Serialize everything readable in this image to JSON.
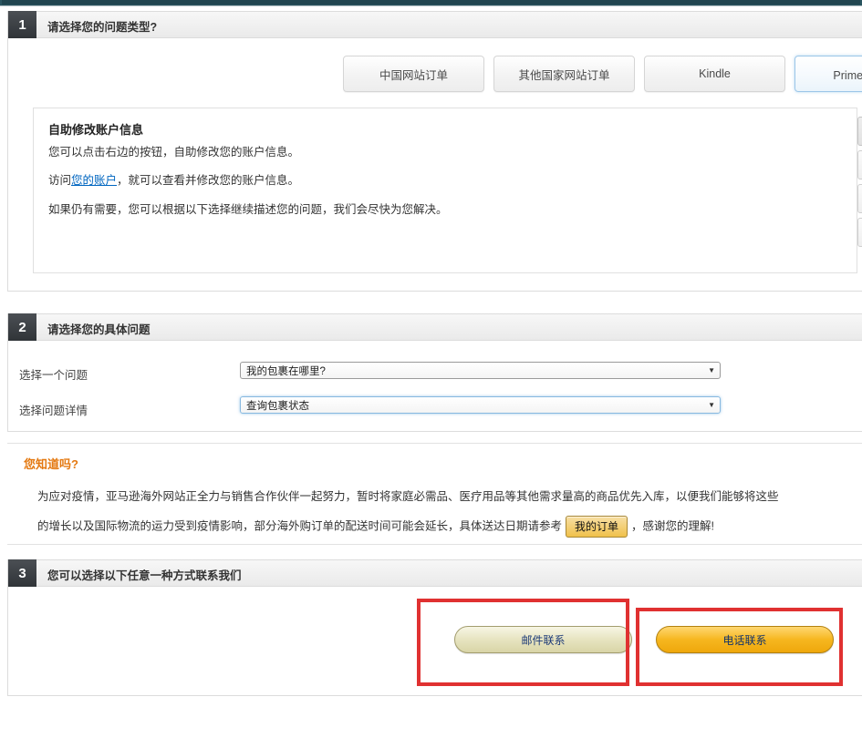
{
  "colors": {
    "topbar": "#21454f",
    "section_number_bg": "#2f3337",
    "accent_orange": "#e47911",
    "annotation_red": "#e03131",
    "link_blue": "#0066c0",
    "phone_button": "#f6b71f",
    "email_button": "#e6e3bf"
  },
  "sections": {
    "one": {
      "number": "1",
      "title": "请选择您的问题类型?",
      "tabs": [
        {
          "label": "中国网站订单",
          "selected": false
        },
        {
          "label": "其他国家网站订单",
          "selected": false
        },
        {
          "label": "Kindle",
          "selected": false
        },
        {
          "label": "Prime会员账",
          "selected": true
        }
      ],
      "info": {
        "heading": "自助修改账户信息",
        "line1": "您可以点击右边的按钮，自助修改您的账户信息。",
        "line2_prefix": "访问",
        "line2_link": "您的账户",
        "line2_suffix": "，就可以查看并修改您的账户信息。",
        "line3": "如果仍有需要，您可以根据以下选择继续描述您的问题，我们会尽快为您解决。"
      },
      "side_buttons": [
        "",
        "",
        "",
        ""
      ],
      "expand_icon": "chevron-double-down"
    },
    "two": {
      "number": "2",
      "title": "请选择您的具体问题",
      "fields": [
        {
          "label": "选择一个问题",
          "value": "我的包裹在哪里?",
          "focused": false,
          "arrow": "▼"
        },
        {
          "label": "选择问题详情",
          "value": "查询包裹状态",
          "focused": true,
          "arrow": "▼"
        }
      ]
    },
    "know": {
      "title": "您知道吗?",
      "line1": "为应对疫情，亚马逊海外网站正全力与销售合作伙伴一起努力，暂时将家庭必需品、医疗用品等其他需求量高的商品优先入库，以便我们能够将这些",
      "line2_before": "的增长以及国际物流的运力受到疫情影响，部分海外购订单的配送时间可能会延长，具体送达日期请参考",
      "line2_button": "我的订单",
      "line2_after": "，感谢您的理解!"
    },
    "three": {
      "number": "3",
      "title": "您可以选择以下任意一种方式联系我们",
      "buttons": [
        {
          "label": "邮件联系",
          "style": "email"
        },
        {
          "label": "电话联系",
          "style": "phone"
        }
      ]
    }
  }
}
